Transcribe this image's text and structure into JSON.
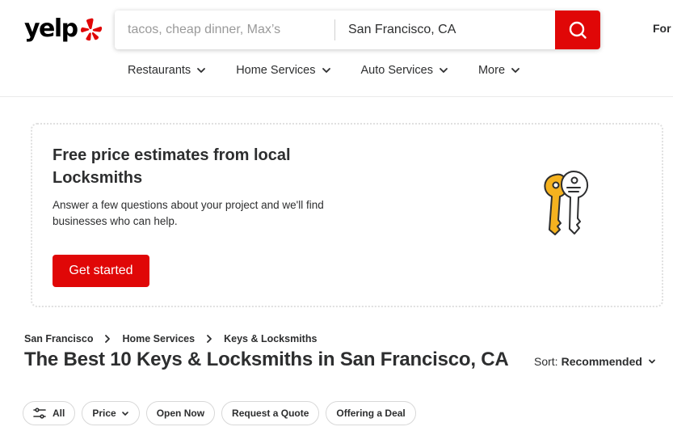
{
  "brand": {
    "logo_text": "yelp",
    "accent": "#e00707",
    "burst_color": "#e00707"
  },
  "search": {
    "find_placeholder": "tacos, cheap dinner, Max’s",
    "near_value": "San Francisco, CA",
    "button_icon": "search-icon"
  },
  "header": {
    "for_business": "For"
  },
  "nav": {
    "items": [
      {
        "label": "Restaurants"
      },
      {
        "label": "Home Services"
      },
      {
        "label": "Auto Services"
      },
      {
        "label": "More"
      }
    ]
  },
  "promo": {
    "title": "Free price estimates from local Locksmiths",
    "description": "Answer a few questions about your project and we'll find businesses who can help.",
    "button": "Get started",
    "icon": "keys-icon"
  },
  "breadcrumb": [
    "San Francisco",
    "Home Services",
    "Keys & Locksmiths"
  ],
  "page_title": "The Best 10 Keys & Locksmiths in San Francisco, CA",
  "sort": {
    "label": "Sort:",
    "value": "Recommended"
  },
  "filters": {
    "all": "All",
    "price": "Price",
    "open_now": "Open Now",
    "request_quote": "Request a Quote",
    "offering_deal": "Offering a Deal"
  }
}
